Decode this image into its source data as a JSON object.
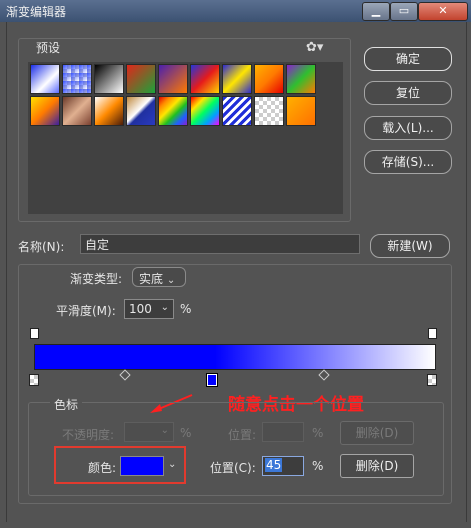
{
  "window": {
    "title": "渐变编辑器",
    "min_glyph": "▁",
    "max_glyph": "▭",
    "close_glyph": "✕"
  },
  "presets": {
    "label": "预设",
    "gear_glyph": "✿▾"
  },
  "buttons": {
    "ok": "确定",
    "reset": "复位",
    "load": "载入(L)...",
    "save": "存储(S)...",
    "new": "新建(W)"
  },
  "name": {
    "label": "名称(N):",
    "value": "自定"
  },
  "gradient": {
    "type_label": "渐变类型:",
    "type_value": "实底",
    "smooth_label": "平滑度(M):",
    "smooth_value": "100",
    "smooth_unit": "%",
    "color_hex": [
      "#0000ff",
      "#ffffff"
    ]
  },
  "stops": {
    "group_label": "色标",
    "opacity_label": "不透明度:",
    "opacity_unit": "%",
    "opacity_position_label": "位置:",
    "opacity_position_unit": "%",
    "opacity_delete": "删除(D)",
    "color_label": "颜色:",
    "color_hex": "#0000ff",
    "color_position_label": "位置(C):",
    "color_position_value": "45",
    "color_position_unit": "%",
    "color_delete": "删除(D)"
  },
  "annotation": {
    "text": "随意点击一个位置",
    "color": "#ff2020"
  }
}
